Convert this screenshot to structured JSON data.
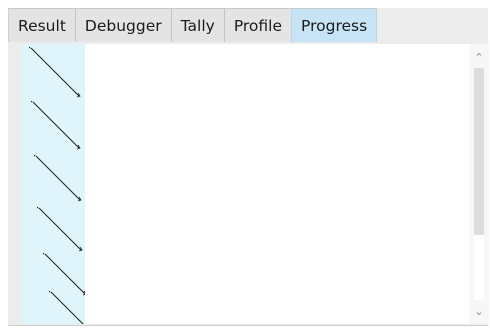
{
  "tabs": [
    {
      "label": "Result",
      "active": false
    },
    {
      "label": "Debugger",
      "active": false
    },
    {
      "label": "Tally",
      "active": false
    },
    {
      "label": "Profile",
      "active": false
    },
    {
      "label": "Progress",
      "active": true
    }
  ],
  "scrollbar": {
    "up_icon": "chevron-up-icon",
    "down_icon": "chevron-down-icon",
    "position_fraction": 0.0,
    "visible_fraction": 0.72
  },
  "progress_tree": {
    "rows": 6
  },
  "colors": {
    "active_tab": "#c7e3f6",
    "gutter": "#dff4fb",
    "background": "#ececec"
  }
}
